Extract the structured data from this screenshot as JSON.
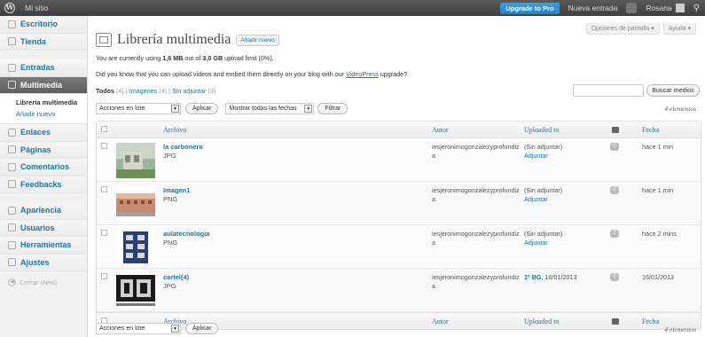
{
  "adminbar": {
    "site_name": "Mi sitio",
    "upgrade_label": "Upgrade to Pro",
    "new_entry_label": "Nueva entrada",
    "user_name": "Rosana"
  },
  "sidebar": {
    "items": [
      {
        "label": "Escritorio"
      },
      {
        "label": "Tienda"
      },
      {
        "label": "Entradas"
      },
      {
        "label": "Multimedia"
      },
      {
        "label": "Enlaces"
      },
      {
        "label": "Páginas"
      },
      {
        "label": "Comentarios"
      },
      {
        "label": "Feedbacks"
      },
      {
        "label": "Apariencia"
      },
      {
        "label": "Usuarios"
      },
      {
        "label": "Herramientas"
      },
      {
        "label": "Ajustes"
      }
    ],
    "submenu": [
      "Librería multimedia",
      "Añadir nuevo"
    ],
    "collapse_label": "Cerrar menú"
  },
  "screen_options": {
    "options_label": "Opciones de pantalla ▾",
    "help_label": "Ayuda ▾"
  },
  "page": {
    "title": "Librería multimedia",
    "add_new_label": "Añadir nuevo",
    "usage_prefix": "You are currently using ",
    "usage_used": "1,6 MB",
    "usage_mid": " out of ",
    "usage_limit": "3,0 GB",
    "usage_suffix": " upload limit (0%).",
    "videopress_prefix": "Did you know that you can upload videos and embed them directly on your blog with our ",
    "videopress_link": "VideoPress",
    "videopress_suffix": " upgrade?"
  },
  "filters": {
    "all": "Todos",
    "all_count": "(4)",
    "images": "Imágenes",
    "images_count": "(4)",
    "unattached": "Sin adjuntar",
    "unattached_count": "(3)",
    "sep": "|"
  },
  "search": {
    "button_label": "Buscar medios"
  },
  "toolbar": {
    "bulk_label": "Acciones en lote",
    "apply_label": "Aplicar",
    "dates_label": "Mostrar todas las fechas",
    "filter_label": "Filtrar",
    "count_label": "4 elementos"
  },
  "table": {
    "headers": {
      "file": "Archivo",
      "author": "Autor",
      "uploaded": "Uploaded to",
      "date": "Fecha"
    },
    "rows": [
      {
        "title": "la carbonera",
        "type": "JPG",
        "author": "iesjeronimogonzalezyprofundiza",
        "uploaded": "(Sin adjuntar)",
        "attach": "Adjuntar",
        "comments": "0",
        "date": "hace 1 min"
      },
      {
        "title": "Imagen1",
        "type": "PNG",
        "author": "iesjeronimogonzalezyprofundiza",
        "uploaded": "(Sin adjuntar)",
        "attach": "Adjuntar",
        "comments": "0",
        "date": "hace 1 min"
      },
      {
        "title": "aulatecnologia",
        "type": "PNG",
        "author": "iesjeronimogonzalezyprofundiza",
        "uploaded": "(Sin adjuntar)",
        "attach": "Adjuntar",
        "comments": "0",
        "date": "hace 2 mins"
      },
      {
        "title": "cartel(4)",
        "type": "JPG",
        "author": "iesjeronimogonzalezyprofundiza",
        "uploaded_link": "1º BG",
        "uploaded_date": ", 16/01/2013",
        "comments": "0",
        "date": "16/01/2013"
      }
    ]
  },
  "colors": {
    "link": "#21759b",
    "adminbar": "#464646",
    "upgrade": "#2283c7"
  }
}
